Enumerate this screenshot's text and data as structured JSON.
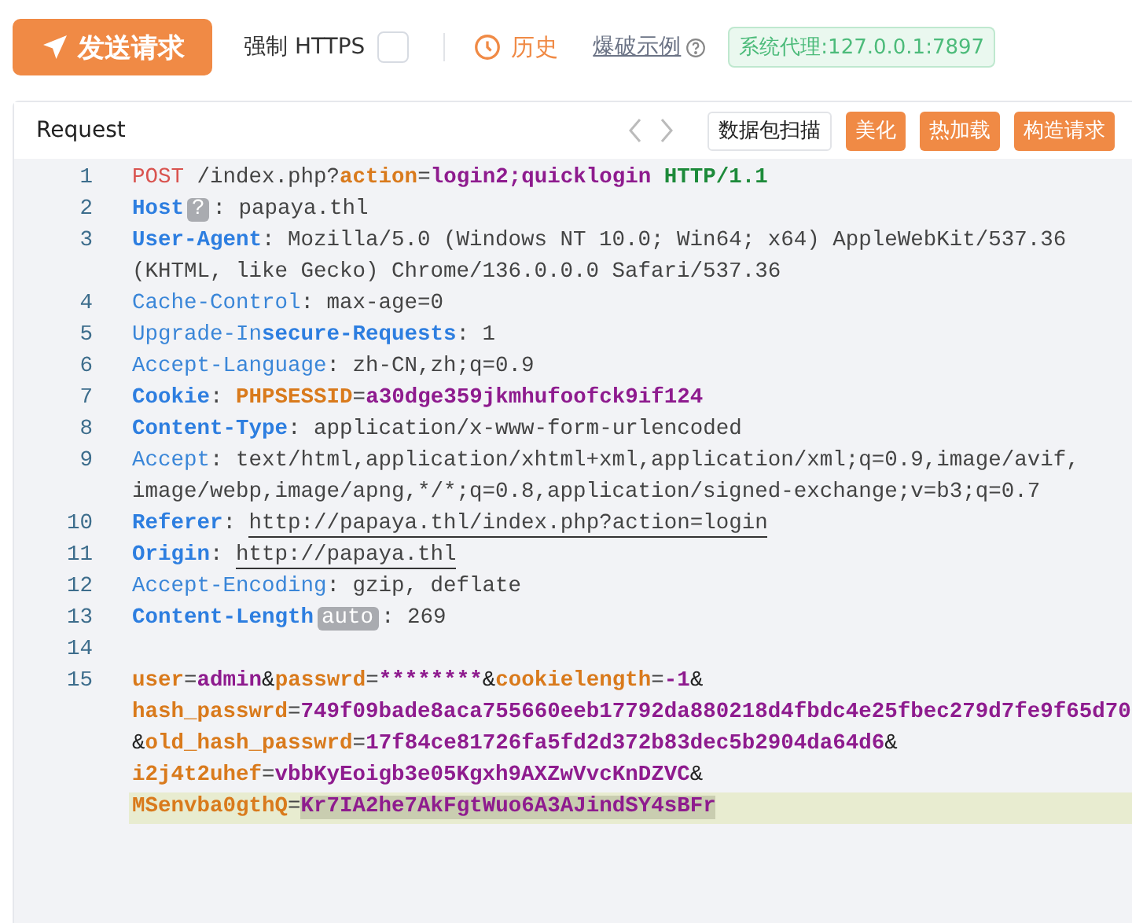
{
  "toolbar": {
    "send_button": "发送请求",
    "force_https": {
      "label": "强制 HTTPS",
      "checked": false
    },
    "history": "历史",
    "examples_link": "爆破示例",
    "proxy_badge": "系统代理:127.0.0.1:7897"
  },
  "request_panel": {
    "title": "Request",
    "buttons": [
      {
        "label": "数据包扫描",
        "kind": "outline"
      },
      {
        "label": "美化",
        "kind": "primary"
      },
      {
        "label": "热加载",
        "kind": "primary"
      },
      {
        "label": "构造请求",
        "kind": "primary"
      }
    ],
    "lines": [
      {
        "number": "1",
        "rows": [
          {
            "active": false,
            "segments": [
              {
                "text": "POST",
                "kind": "method"
              },
              {
                "text": " /index.php?",
                "kind": "plain"
              },
              {
                "text": "action",
                "kind": "param"
              },
              {
                "text": "=",
                "kind": "plain"
              },
              {
                "text": "login2;quicklogin",
                "kind": "pvalue"
              },
              {
                "text": " HTTP/1.1",
                "kind": "version"
              }
            ]
          }
        ]
      },
      {
        "number": "2",
        "rows": [
          {
            "active": false,
            "segments": [
              {
                "text": "Host",
                "kind": "keyb"
              },
              {
                "text": "?",
                "kind": "badge"
              },
              {
                "text": ": papaya.thl",
                "kind": "plain"
              }
            ]
          }
        ]
      },
      {
        "number": "3",
        "rows": [
          {
            "active": false,
            "segments": [
              {
                "text": "User-Agent",
                "kind": "keyb"
              },
              {
                "text": ": Mozilla/5.0 (Windows NT 10.0; Win64; x64) AppleWebKit/537.36",
                "kind": "plain"
              }
            ]
          },
          {
            "active": false,
            "segments": [
              {
                "text": "(KHTML, like Gecko) Chrome/136.0.0.0 Safari/537.36",
                "kind": "plain"
              }
            ]
          }
        ]
      },
      {
        "number": "4",
        "rows": [
          {
            "active": false,
            "segments": [
              {
                "text": "Cache-Control",
                "kind": "key"
              },
              {
                "text": ": max-age=0",
                "kind": "plain"
              }
            ]
          }
        ]
      },
      {
        "number": "5",
        "rows": [
          {
            "active": false,
            "segments": [
              {
                "text": "Upgrade-In",
                "kind": "key"
              },
              {
                "text": "secure-Requests",
                "kind": "keyb"
              },
              {
                "text": ": 1",
                "kind": "plain"
              }
            ]
          }
        ]
      },
      {
        "number": "6",
        "rows": [
          {
            "active": false,
            "segments": [
              {
                "text": "Accept-Language",
                "kind": "key"
              },
              {
                "text": ": zh-CN,zh;q=0.9",
                "kind": "plain"
              }
            ]
          }
        ]
      },
      {
        "number": "7",
        "rows": [
          {
            "active": false,
            "segments": [
              {
                "text": "Cookie",
                "kind": "keyb"
              },
              {
                "text": ": ",
                "kind": "plain"
              },
              {
                "text": "PHPSESSID",
                "kind": "param"
              },
              {
                "text": "=",
                "kind": "plain"
              },
              {
                "text": "a30dge359jkmhufoofck9if124",
                "kind": "pvalue"
              }
            ]
          }
        ]
      },
      {
        "number": "8",
        "rows": [
          {
            "active": false,
            "segments": [
              {
                "text": "Content-Type",
                "kind": "keyb"
              },
              {
                "text": ": application/x-www-form-urlencoded",
                "kind": "plain"
              }
            ]
          }
        ]
      },
      {
        "number": "9",
        "rows": [
          {
            "active": false,
            "segments": [
              {
                "text": "Accept",
                "kind": "key"
              },
              {
                "text": ": text/html,application/xhtml+xml,application/xml;q=0.9,image/avif,",
                "kind": "plain"
              }
            ]
          },
          {
            "active": false,
            "segments": [
              {
                "text": "image/webp,image/apng,*/*;q=0.8,application/signed-exchange;v=b3;q=0.7",
                "kind": "plain"
              }
            ]
          }
        ]
      },
      {
        "number": "10",
        "rows": [
          {
            "active": false,
            "segments": [
              {
                "text": "Referer",
                "kind": "keyb"
              },
              {
                "text": ": ",
                "kind": "plain"
              },
              {
                "text": "http://papaya.thl/index.php?action=login",
                "kind": "link"
              }
            ]
          }
        ]
      },
      {
        "number": "11",
        "rows": [
          {
            "active": false,
            "segments": [
              {
                "text": "Origin",
                "kind": "keyb"
              },
              {
                "text": ": ",
                "kind": "plain"
              },
              {
                "text": "http://papaya.thl",
                "kind": "link"
              }
            ]
          }
        ]
      },
      {
        "number": "12",
        "rows": [
          {
            "active": false,
            "segments": [
              {
                "text": "Accept-Encoding",
                "kind": "key"
              },
              {
                "text": ": gzip, deflate",
                "kind": "plain"
              }
            ]
          }
        ]
      },
      {
        "number": "13",
        "rows": [
          {
            "active": false,
            "segments": [
              {
                "text": "Content-Length",
                "kind": "keyb"
              },
              {
                "text": "auto",
                "kind": "badge"
              },
              {
                "text": ": 269",
                "kind": "plain"
              }
            ]
          }
        ]
      },
      {
        "number": "14",
        "rows": [
          {
            "active": false
          }
        ]
      },
      {
        "number": "15",
        "rows": [
          {
            "active": false,
            "segments": [
              {
                "text": "user",
                "kind": "param"
              },
              {
                "text": "=",
                "kind": "plain"
              },
              {
                "text": "admin",
                "kind": "pvalue"
              },
              {
                "text": "&",
                "kind": "amp"
              },
              {
                "text": "passwrd",
                "kind": "param"
              },
              {
                "text": "=",
                "kind": "plain"
              },
              {
                "text": "********",
                "kind": "pvalue"
              },
              {
                "text": "&",
                "kind": "amp"
              },
              {
                "text": "cookielength",
                "kind": "param"
              },
              {
                "text": "=",
                "kind": "plain"
              },
              {
                "text": "-1",
                "kind": "pvalue"
              },
              {
                "text": "&",
                "kind": "amp"
              }
            ]
          },
          {
            "active": false,
            "segments": [
              {
                "text": "hash_passwrd",
                "kind": "param"
              },
              {
                "text": "=",
                "kind": "plain"
              },
              {
                "text": "749f09bade8aca755660eeb17792da880218d4fbdc4e25fbec279d7fe9f65d70",
                "kind": "pvalue"
              }
            ]
          },
          {
            "active": false,
            "segments": [
              {
                "text": "&",
                "kind": "amp"
              },
              {
                "text": "old_hash_passwrd",
                "kind": "param"
              },
              {
                "text": "=",
                "kind": "plain"
              },
              {
                "text": "17f84ce81726fa5fd2d372b83dec5b2904da64d6",
                "kind": "pvalue"
              },
              {
                "text": "&",
                "kind": "amp"
              }
            ]
          },
          {
            "active": false,
            "segments": [
              {
                "text": "i2j4t2uhef",
                "kind": "param"
              },
              {
                "text": "=",
                "kind": "plain"
              },
              {
                "text": "vbbKyEoigb3e05Kgxh9AXZwVvcKnDZVC",
                "kind": "pvalue"
              },
              {
                "text": "&",
                "kind": "amp"
              }
            ]
          },
          {
            "active": true,
            "segments": [
              {
                "text": "MSenvba0gthQ",
                "kind": "param"
              },
              {
                "text": "=",
                "kind": "plain"
              },
              {
                "text": "Kr7IA2he7AkFgtWuo6A3AJindSY4sBFr",
                "kind": "pvalue",
                "selected": true
              }
            ]
          }
        ]
      }
    ]
  }
}
